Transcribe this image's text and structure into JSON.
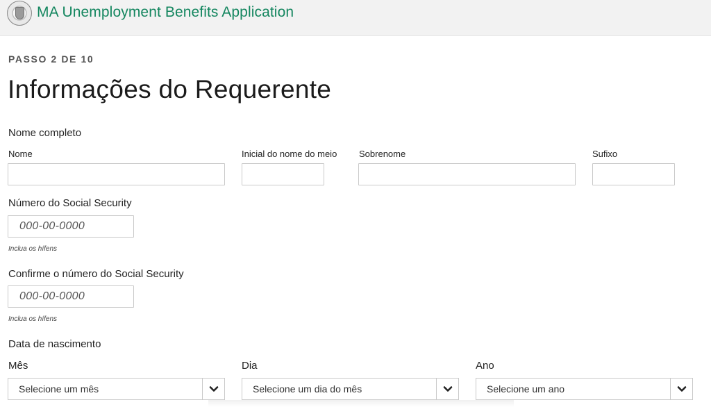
{
  "header": {
    "app_title": "MA Unemployment Benefits Application",
    "seal_icon": "massachusetts-seal-icon"
  },
  "step": "PASSO 2 DE 10",
  "page_title": "Informações do Requerente",
  "full_name": {
    "section_label": "Nome completo",
    "first_label": "Nome",
    "middle_label": "Inicial do nome do meio",
    "last_label": "Sobrenome",
    "suffix_label": "Sufixo"
  },
  "ssn": {
    "label": "Número do Social Security",
    "placeholder": "000-00-0000",
    "hint": "Inclua os hífens"
  },
  "ssn_confirm": {
    "label": "Confirme o número do Social Security",
    "placeholder": "000-00-0000",
    "hint": "Inclua os hífens"
  },
  "dob": {
    "section_label": "Data de nascimento",
    "month_label": "Mês",
    "month_value": "Selecione um mês",
    "day_label": "Dia",
    "day_value": "Selecione um dia do mês",
    "year_label": "Ano",
    "year_value": "Selecione um ano"
  },
  "colors": {
    "brand_green": "#14865f",
    "border": "#c9c9c9"
  }
}
